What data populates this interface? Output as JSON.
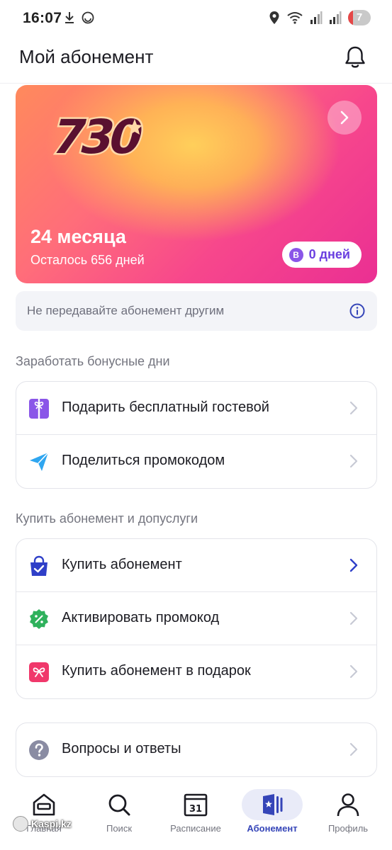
{
  "status_bar": {
    "time": "16:07",
    "battery_level": "7",
    "icons": [
      "download-icon",
      "sync-icon",
      "location-icon",
      "wifi-icon",
      "signal-icon",
      "signal-icon",
      "battery-icon"
    ]
  },
  "header": {
    "title": "Мой абонемент",
    "icon": "bell-icon"
  },
  "card": {
    "logo_text": "730",
    "duration": "24 месяца",
    "remaining": "Осталось 656 дней",
    "bonus_badge": "B",
    "bonus_days": "0 дней",
    "colors": {
      "gradient_start": "#ff8a5c",
      "gradient_mid": "#ffcf5a",
      "gradient_end": "#ea2f93"
    }
  },
  "notice": {
    "text": "Не передавайте абонемент другим",
    "icon": "info-icon"
  },
  "sections": {
    "bonus_title": "Заработать бонусные дни",
    "bonus_items": [
      {
        "label": "Подарить бесплатный гостевой",
        "icon": "gift-icon"
      },
      {
        "label": "Поделиться промокодом",
        "icon": "send-icon"
      }
    ],
    "buy_title": "Купить абонемент и допуслуги",
    "buy_items": [
      {
        "label": "Купить абонемент",
        "icon": "shopping-bag-icon"
      },
      {
        "label": "Активировать промокод",
        "icon": "percent-badge-icon"
      },
      {
        "label": "Купить абонемент в подарок",
        "icon": "gift-bow-icon"
      }
    ],
    "faq_items": [
      {
        "label": "Вопросы и ответы",
        "icon": "question-icon"
      }
    ]
  },
  "bottom_nav": {
    "items": [
      {
        "label": "Главная",
        "icon": "home-icon"
      },
      {
        "label": "Поиск",
        "icon": "search-icon"
      },
      {
        "label": "Расписание",
        "icon": "calendar-icon",
        "calendar_day": "31"
      },
      {
        "label": "Абонемент",
        "icon": "membership-card-icon",
        "active": true
      },
      {
        "label": "Профиль",
        "icon": "profile-icon"
      }
    ]
  },
  "watermark": {
    "text": "Kaspi.kz"
  },
  "colors": {
    "accent": "#3545b8",
    "purple": "#8a56e8",
    "green": "#2fb15c",
    "pink": "#f0386b",
    "blue": "#2f3fc8",
    "sky": "#2fa6f0"
  }
}
